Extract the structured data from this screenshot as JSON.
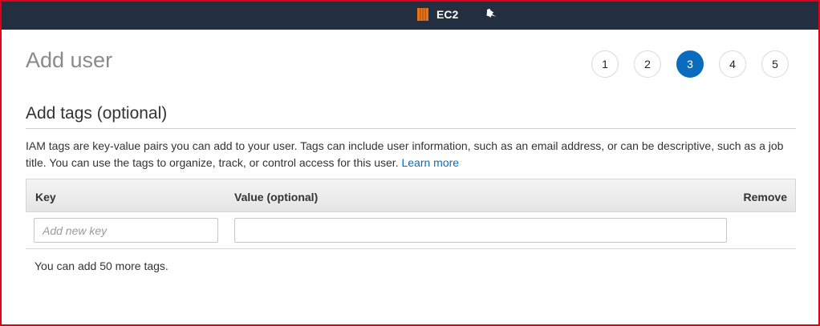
{
  "topbar": {
    "service_label": "EC2",
    "service_icon": "ec2-icon",
    "pin_icon": "pin-icon"
  },
  "page": {
    "title": "Add user"
  },
  "steps": {
    "items": [
      "1",
      "2",
      "3",
      "4",
      "5"
    ],
    "active": "3",
    "active_color": "#0b6cbd"
  },
  "tags": {
    "section_title": "Add tags (optional)",
    "description": "IAM tags are key-value pairs you can add to your user. Tags can include user information, such as an email address, or can be descriptive, such as a job title. You can use the tags to organize, track, or control access for this user.",
    "learn_more": "Learn more",
    "columns": {
      "key": "Key",
      "value": "Value (optional)",
      "remove": "Remove"
    },
    "row": {
      "key_value": "",
      "key_placeholder": "Add new key",
      "value_value": "",
      "value_placeholder": ""
    },
    "remaining_text": "You can add 50 more tags."
  },
  "colors": {
    "topbar": "#232f3e",
    "link": "#0b6cbd",
    "ec2_orange": "#e8731b"
  }
}
